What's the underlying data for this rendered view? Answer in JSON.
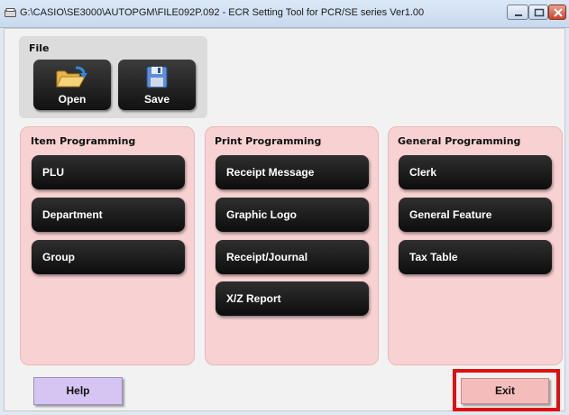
{
  "window": {
    "title": "G:\\CASIO\\SE3000\\AUTOPGM\\FILE092P.092 - ECR Setting Tool for PCR/SE series Ver1.00"
  },
  "file_panel": {
    "title": "File",
    "open_label": "Open",
    "save_label": "Save"
  },
  "item_programming": {
    "title": "Item Programming",
    "buttons": [
      "PLU",
      "Department",
      "Group"
    ]
  },
  "print_programming": {
    "title": "Print Programming",
    "buttons": [
      "Receipt Message",
      "Graphic Logo",
      "Receipt/Journal",
      "X/Z Report"
    ]
  },
  "general_programming": {
    "title": "General Programming",
    "buttons": [
      "Clerk",
      "General Feature",
      "Tax Table"
    ]
  },
  "footer": {
    "help_label": "Help",
    "exit_label": "Exit"
  },
  "colors": {
    "panel_pink": "#f8d2d2",
    "help_purple": "#d6c4f3",
    "exit_pink": "#f5bcbc",
    "highlight_red": "#e01010"
  }
}
